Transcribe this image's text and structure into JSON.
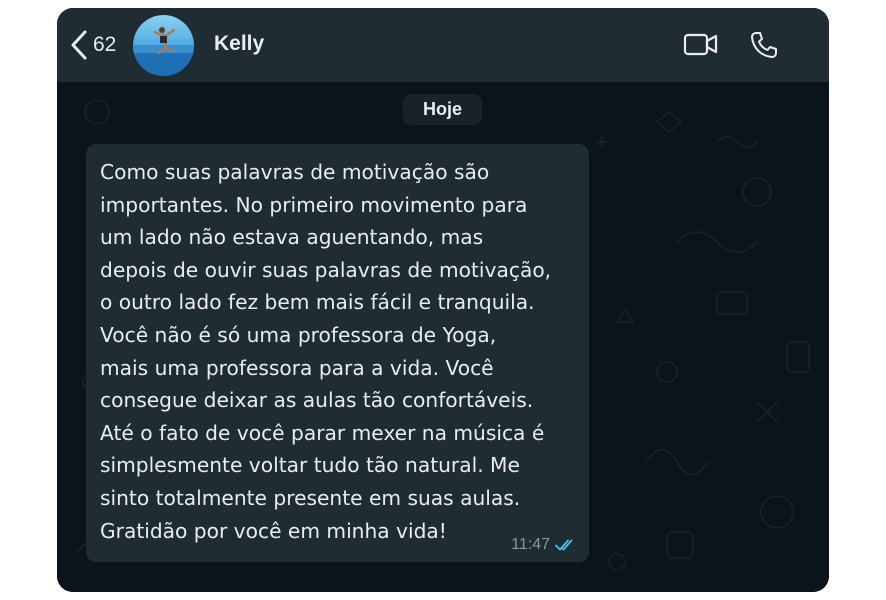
{
  "header": {
    "back_count": "62",
    "contact_name": "Kelly",
    "video_icon": "video-camera-icon",
    "call_icon": "phone-icon"
  },
  "chat": {
    "date_label": "Hoje",
    "messages": [
      {
        "text": "Como suas palavras de motivação são\nimportantes. No primeiro movimento para\num lado não estava aguentando, mas\ndepois de ouvir suas palavras de motivação,\no outro lado fez bem mais fácil e tranquila.\nVocê não é só uma professora de Yoga,\nmais uma professora para a vida. Você\nconsegue deixar as aulas tão confortáveis.\nAté o fato de você parar mexer na música é\nsimplesmente voltar tudo tão natural. Me\nsinto totalmente presente em suas aulas.\nGratidão por você em minha vida!",
        "time": "11:47",
        "status_icon": "double-check-icon"
      }
    ]
  },
  "colors": {
    "header_bg": "#1f2c34",
    "chat_bg": "#0b141a",
    "bubble_bg": "#1f2c34",
    "text": "#e9edef",
    "meta_text": "#8696a0",
    "read_tick": "#53bdeb"
  }
}
